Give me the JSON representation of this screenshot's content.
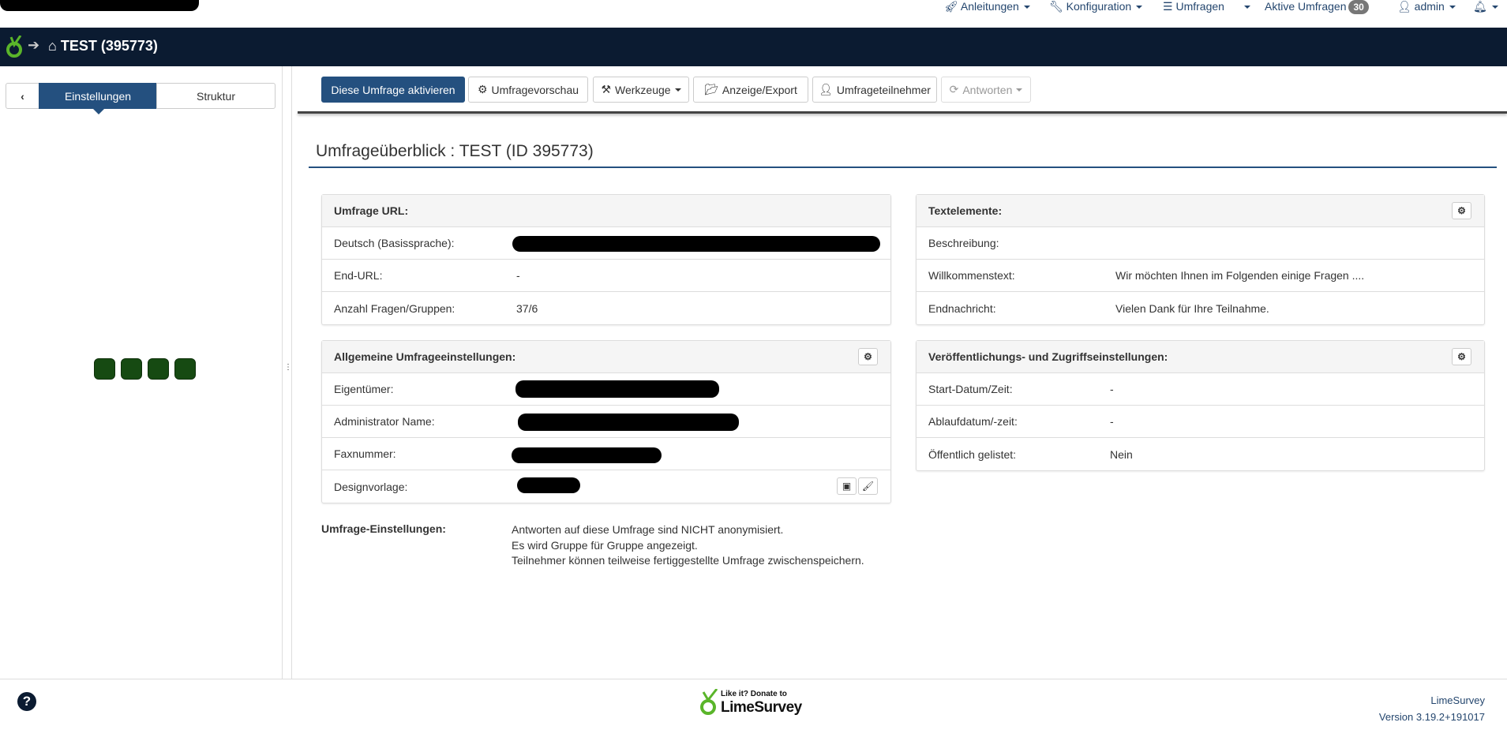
{
  "topnav": {
    "items": [
      {
        "label": "Anleitungen",
        "icon": "rocket-icon"
      },
      {
        "label": "Konfiguration",
        "icon": "wrench-icon"
      },
      {
        "label": "Umfragen",
        "icon": "list-icon"
      },
      {
        "label": "Aktive Umfragen",
        "badge": "30"
      },
      {
        "label": "admin",
        "icon": "user-icon"
      },
      {
        "label": "",
        "icon": "bell-icon"
      }
    ]
  },
  "navbar": {
    "breadcrumb": "TEST (395773)"
  },
  "sidebar": {
    "tabs": [
      {
        "label": "Einstellungen",
        "active": true
      },
      {
        "label": "Struktur",
        "active": false
      }
    ]
  },
  "toolbar": {
    "activate": "Diese Umfrage aktivieren",
    "preview": "Umfragevorschau",
    "tools": "Werkzeuge",
    "display_export": "Anzeige/Export",
    "participants": "Umfrageteilnehmer",
    "responses": "Antworten"
  },
  "page_title": "Umfrageüberblick : TEST (ID 395773)",
  "panels": {
    "url": {
      "title": "Umfrage URL:",
      "rows": [
        {
          "label": "Deutsch (Basissprache):",
          "value": ""
        },
        {
          "label": "End-URL:",
          "value": "-"
        },
        {
          "label": "Anzahl Fragen/Gruppen:",
          "value": "37/6"
        }
      ]
    },
    "general": {
      "title": "Allgemeine Umfrageeinstellungen:",
      "rows": [
        {
          "label": "Eigentümer:",
          "value": ""
        },
        {
          "label": "Administrator Name:",
          "value": ""
        },
        {
          "label": "Faxnummer:",
          "value": ""
        },
        {
          "label": "Designvorlage:",
          "value": ""
        }
      ]
    },
    "text": {
      "title": "Textelemente:",
      "rows": [
        {
          "label": "Beschreibung:",
          "value": ""
        },
        {
          "label": "Willkommenstext:",
          "value": "Wir möchten Ihnen im Folgenden einige Fragen ...."
        },
        {
          "label": "Endnachricht:",
          "value": "Vielen Dank für Ihre Teilnahme."
        }
      ]
    },
    "publication": {
      "title": "Veröffentlichungs- und Zugriffseinstellungen:",
      "rows": [
        {
          "label": "Start-Datum/Zeit:",
          "value": "-"
        },
        {
          "label": "Ablaufdatum/-zeit:",
          "value": "-"
        },
        {
          "label": "Öffentlich gelistet:",
          "value": "Nein"
        }
      ]
    }
  },
  "survey_settings": {
    "label": "Umfrage-Einstellungen:",
    "lines": [
      "Antworten auf diese Umfrage sind NICHT anonymisiert.",
      "Es wird Gruppe für Gruppe angezeigt.",
      "Teilnehmer können teilweise fertiggestellte Umfrage zwischenspeichern."
    ]
  },
  "footer": {
    "donate_small": "Like it? Donate to",
    "donate_brand": "LimeSurvey",
    "app_name": "LimeSurvey",
    "version": "Version 3.19.2+191017"
  },
  "colors": {
    "navbar": "#0b1b31",
    "primary": "#24507f",
    "link": "#24466e",
    "lime": "#5ab52a"
  }
}
